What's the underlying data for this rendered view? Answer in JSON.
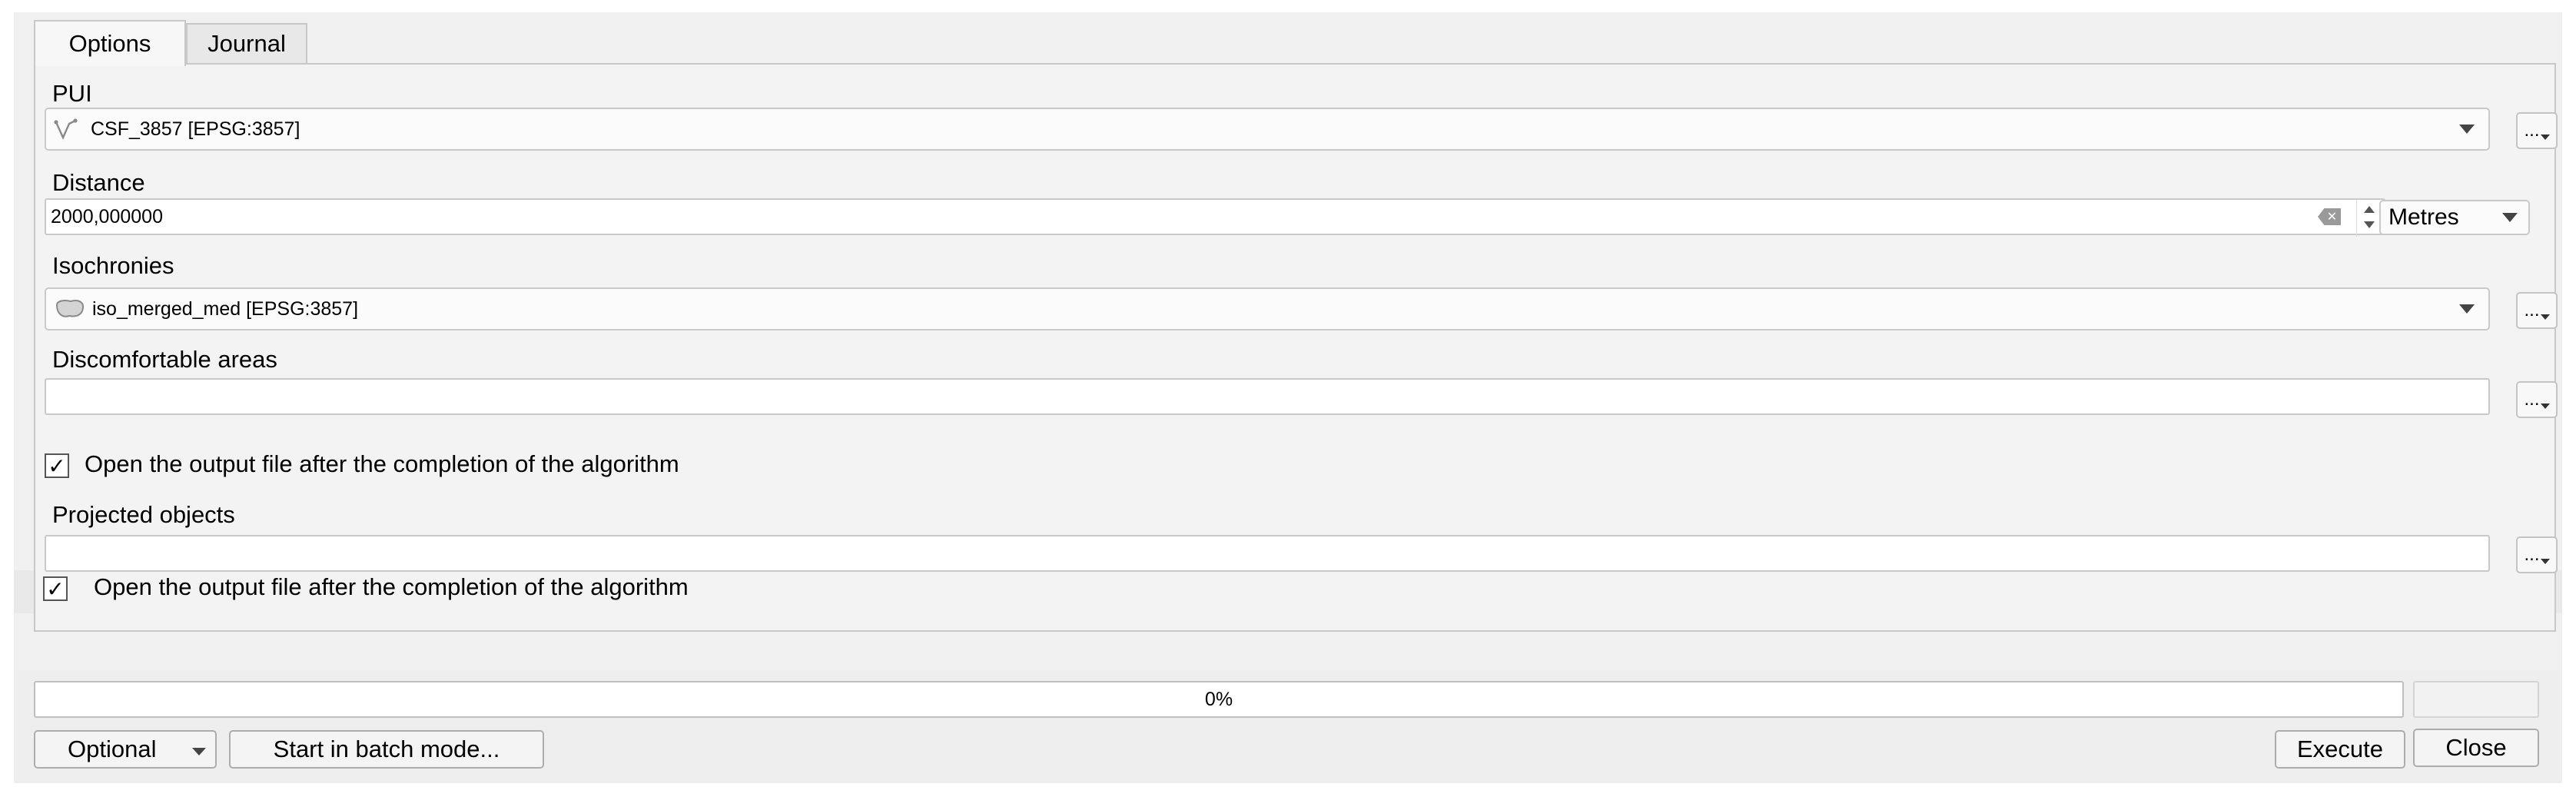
{
  "tabs": [
    {
      "label": "Options",
      "active": true
    },
    {
      "label": "Journal",
      "active": false
    }
  ],
  "pui": {
    "label": "PUI",
    "value": "CSF_3857 [EPSG:3857]",
    "icon": "line-layer-icon"
  },
  "distance": {
    "label": "Distance",
    "value": "2000,000000",
    "units": "Metres"
  },
  "isochronies": {
    "label": "Isochronies",
    "value": "iso_merged_med [EPSG:3857]",
    "icon": "polygon-layer-icon"
  },
  "discomfortable": {
    "label": "Discomfortable areas",
    "value": "",
    "open_after": {
      "label": "Open the output file after the completion of the algorithm",
      "checked": true
    }
  },
  "projected": {
    "label": "Projected objects",
    "value": "",
    "open_after": {
      "label": "Open the output file after the completion of the algorithm",
      "checked": true
    }
  },
  "browse_label": "...",
  "progress": {
    "text": "0%",
    "value": 0
  },
  "buttons": {
    "optional": "Optional",
    "batch": "Start in batch mode...",
    "execute": "Execute",
    "close": "Close"
  }
}
